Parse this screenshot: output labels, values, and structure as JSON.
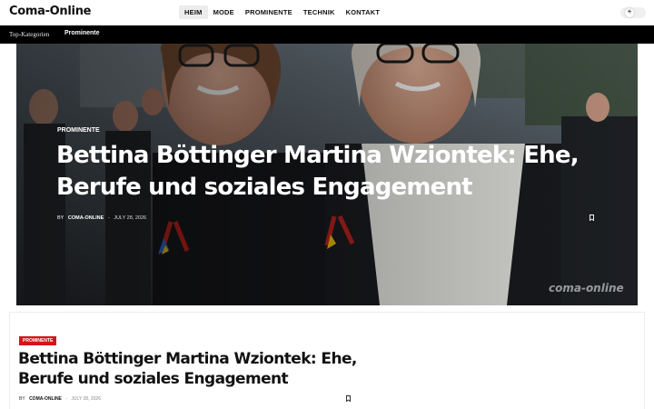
{
  "header": {
    "logo": "Coma-Online",
    "nav": [
      {
        "label": "HEIM",
        "active": true
      },
      {
        "label": "MODE",
        "active": false
      },
      {
        "label": "PROMINENTE",
        "active": false
      },
      {
        "label": "TECHNIK",
        "active": false
      },
      {
        "label": "KONTAKT",
        "active": false
      }
    ],
    "theme_icon": "sun-icon"
  },
  "subbar": {
    "label": "Top-Kategorien",
    "link": "Prominente"
  },
  "hero": {
    "category": "PROMINENTE",
    "title": "Bettina Böttinger Martina Wziontek: Ehe, Berufe und soziales Engagement",
    "by": "BY",
    "author": "COMA-ONLINE",
    "separator": "-",
    "date": "JULY 28, 2026",
    "watermark": "coma-online",
    "bookmark_icon": "bookmark-icon"
  },
  "card": {
    "category": "PROMINENTE",
    "title": "Bettina Böttinger Martina Wziontek: Ehe, Berufe und soziales Engagement",
    "by": "BY",
    "author": "COMA-ONLINE",
    "separator": "-",
    "date": "JULY 28, 2026",
    "bookmark_icon": "bookmark-icon"
  },
  "colors": {
    "badge": "#d4141c",
    "subbar": "#000000",
    "active_nav_bg": "#ececec"
  }
}
